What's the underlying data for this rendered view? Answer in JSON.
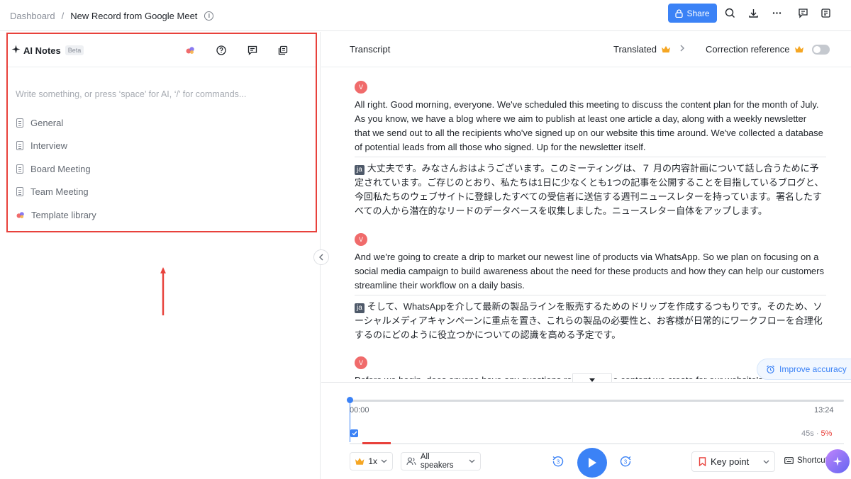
{
  "breadcrumb": {
    "root": "Dashboard",
    "separator": "/",
    "title": "New Record from Google Meet"
  },
  "toolbar": {
    "share_label": "Share"
  },
  "ai_notes": {
    "title": "AI Notes",
    "badge": "Beta",
    "placeholder": "Write something, or press ‘space’ for AI, ‘/’ for commands...",
    "templates": [
      "General",
      "Interview",
      "Board Meeting",
      "Team Meeting",
      "Template library"
    ]
  },
  "transcript": {
    "title": "Transcript",
    "translated_label": "Translated",
    "correction_label": "Correction reference",
    "segments": [
      {
        "speaker": "V",
        "text": "All right. Good morning, everyone. We've scheduled this meeting to discuss the content plan for the month of July. As you know, we have a blog where we aim to publish at least one article a day, along with a weekly newsletter that we send out to all the recipients who've signed up on our website this time around. We've collected a database of potential leads from all those who signed. Up for the newsletter itself.",
        "lang": "ja",
        "translation": "大丈夫です。みなさんおはようございます。このミーティングは、７ 月の内容計画について話し合うために予定されています。ご存じのとおり、私たちは1日に少なくとも1つの記事を公開することを目指しているブログと、今回私たちのウェブサイトに登録したすべての受信者に送信する週刊ニュースレターを持っています。署名したすべての人から潜在的なリードのデータベースを収集しました。ニュースレター自体をアップします。"
      },
      {
        "speaker": "V",
        "text": "And we're going to create a drip to market our newest line of products via WhatsApp. So we plan on focusing on a social media campaign to build awareness about the need for these products and how they can help our customers streamline their workflow on a daily basis.",
        "lang": "ja",
        "translation": "そして、WhatsAppを介して最新の製品ラインを販売するためのドリップを作成するつもりです。そのため、ソーシャルメディアキャンペーンに重点を置き、これらの製品の必要性と、お客様が日常的にワークフローを合理化するのにどのように役立つかについての認識を高める予定です。"
      },
      {
        "speaker": "V",
        "text": "Before we begin, does anyone have any questions regarding the content we create for our website's blog? If not",
        "lang": "",
        "translation": ""
      }
    ],
    "improve_label": "Improve accuracy"
  },
  "player": {
    "time_start": "00:00",
    "time_end": "13:24",
    "progress": 0.0,
    "stat_time": "45s",
    "stat_sep": "·",
    "stat_pct": "5%",
    "speed": "1x",
    "speakers": "All speakers",
    "skip_back": "3",
    "skip_forward": "3",
    "keypoint": "Key point",
    "shortcut": "Shortcuts"
  },
  "colors": {
    "accent": "#3b82f6",
    "highlight": "#e8413b",
    "avatar": "#f06b6b"
  }
}
